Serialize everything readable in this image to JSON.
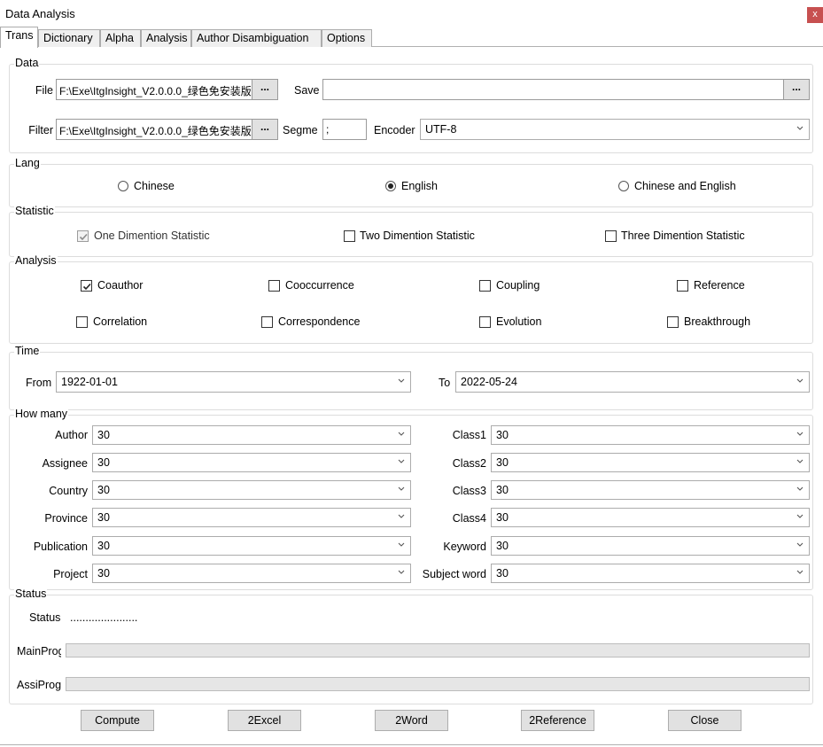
{
  "window": {
    "title": "Data Analysis",
    "close_label": "x"
  },
  "tabs": [
    "Trans",
    "Dictionary",
    "Alpha",
    "Analysis",
    "Author Disambiguation",
    "Options"
  ],
  "data_group": {
    "label": "Data",
    "file_label": "File",
    "file_value": "F:\\Exe\\ItgInsight_V2.0.0.0_绿色免安装版",
    "save_label": "Save",
    "save_value": "",
    "filter_label": "Filter",
    "filter_value": "F:\\Exe\\ItgInsight_V2.0.0.0_绿色免安装版",
    "segme_label": "Segme",
    "segme_value": ";",
    "encoder_label": "Encoder",
    "encoder_value": "UTF-8",
    "browse_label": "..."
  },
  "lang_group": {
    "label": "Lang",
    "options": [
      "Chinese",
      "English",
      "Chinese and English"
    ],
    "selected": "English"
  },
  "statistic_group": {
    "label": "Statistic",
    "options": [
      {
        "label": "One Dimention Statistic",
        "checked": true,
        "disabled": true
      },
      {
        "label": "Two Dimention Statistic",
        "checked": false
      },
      {
        "label": "Three Dimention Statistic",
        "checked": false
      }
    ]
  },
  "analysis_group": {
    "label": "Analysis",
    "options": [
      {
        "label": "Coauthor",
        "checked": true
      },
      {
        "label": "Cooccurrence",
        "checked": false
      },
      {
        "label": "Coupling",
        "checked": false
      },
      {
        "label": "Reference",
        "checked": false
      },
      {
        "label": "Correlation",
        "checked": false
      },
      {
        "label": "Correspondence",
        "checked": false
      },
      {
        "label": "Evolution",
        "checked": false
      },
      {
        "label": "Breakthrough",
        "checked": false
      }
    ]
  },
  "time_group": {
    "label": "Time",
    "from_label": "From",
    "from_value": "1922-01-01",
    "to_label": "To",
    "to_value": "2022-05-24"
  },
  "howmany_group": {
    "label": "How many",
    "left": [
      {
        "label": "Author",
        "value": "30"
      },
      {
        "label": "Assignee",
        "value": "30"
      },
      {
        "label": "Country",
        "value": "30"
      },
      {
        "label": "Province",
        "value": "30"
      },
      {
        "label": "Publication",
        "value": "30"
      },
      {
        "label": "Project",
        "value": "30"
      }
    ],
    "right": [
      {
        "label": "Class1",
        "value": "30"
      },
      {
        "label": "Class2",
        "value": "30"
      },
      {
        "label": "Class3",
        "value": "30"
      },
      {
        "label": "Class4",
        "value": "30"
      },
      {
        "label": "Keyword",
        "value": "30"
      },
      {
        "label": "Subject word",
        "value": "30"
      }
    ]
  },
  "status_group": {
    "label": "Status",
    "status_label": "Status",
    "status_value": "......................",
    "mainprog_label": "MainProg",
    "mainprog_progress": 0,
    "assiprog_label": "AssiProg",
    "assiprog_progress": 0
  },
  "buttons": [
    "Compute",
    "2Excel",
    "2Word",
    "2Reference",
    "Close"
  ],
  "colors": {
    "close_bg": "#c75050",
    "accent": "#0078d7"
  }
}
